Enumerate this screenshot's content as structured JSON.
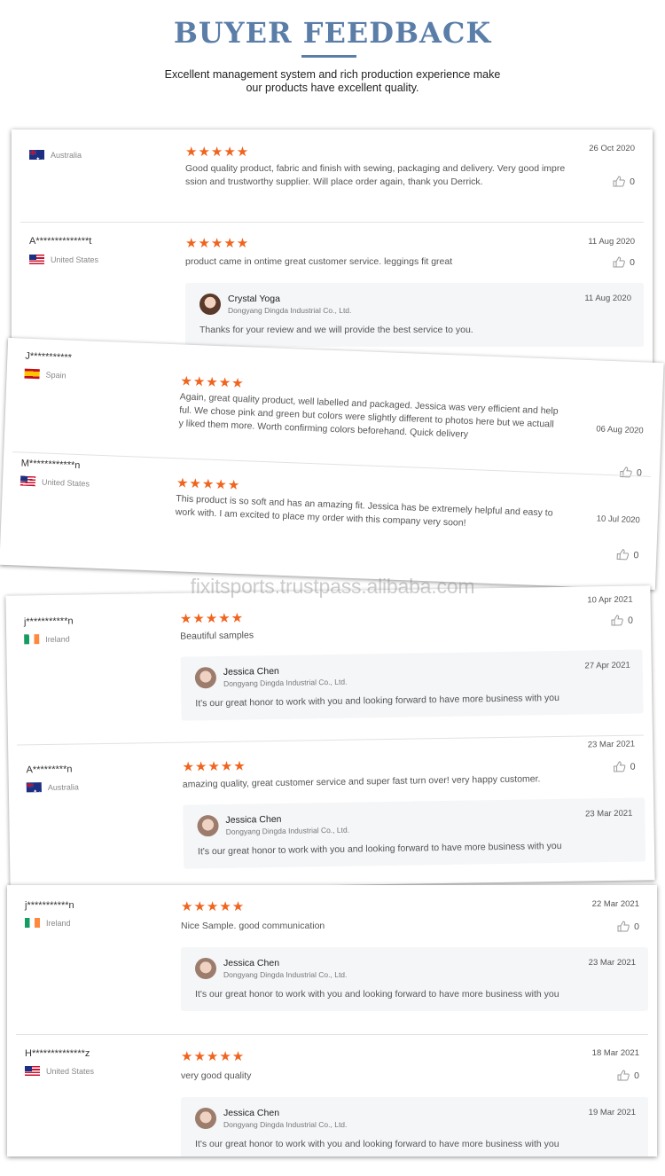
{
  "header": {
    "title": "BUYER FEEDBACK",
    "subtitle_line1": "Excellent management system and rich production experience make",
    "subtitle_line2": "our products have excellent quality."
  },
  "watermark": "fixitsports.trustpass.alibaba.com",
  "stars": "★★★★★",
  "reply_company": "Dongyang Dingda Industrial Co., Ltd.",
  "colors": {
    "title": "#5b7ea8",
    "stars": "#f0641e",
    "reply_bg": "#f5f6f8"
  },
  "cards": [
    {
      "reviews": [
        {
          "name": "",
          "country": "Australia",
          "flag": "australia-flag-icon",
          "date": "26 Oct 2020",
          "text_lines": [
            "Good quality product, fabric and finish with sewing, packaging and delivery. Very good impre",
            "ssion and trustworthy supplier. Will place order again, thank you Derrick."
          ],
          "likes": "0"
        },
        {
          "name": "A**************t",
          "country": "United States",
          "flag": "us-flag-icon",
          "date": "11 Aug 2020",
          "text_lines": [
            "product came in ontime great customer service. leggings fit great"
          ],
          "likes": "0",
          "reply": {
            "name": "Crystal Yoga",
            "date": "11 Aug 2020",
            "text": "Thanks for your review and we will provide the best service to you."
          }
        }
      ]
    },
    {
      "reviews": [
        {
          "name": "J***********",
          "country": "Spain",
          "flag": "spain-flag-icon",
          "date": "06 Aug 2020",
          "text_lines": [
            "Again, great quality product, well labelled and packaged. Jessica was very efficient and help",
            "ful. We chose pink and green but colors were slightly different to photos here but we actuall",
            "y liked them more. Worth confirming colors beforehand. Quick delivery"
          ],
          "likes": "0"
        },
        {
          "name": "M************n",
          "country": "United States",
          "flag": "us-flag-icon",
          "date": "10 Jul 2020",
          "text_lines": [
            "This product is so soft and has an amazing fit. Jessica has be extremely helpful and easy to",
            "work with. I am excited to place my order with this company very soon!"
          ],
          "likes": "0"
        }
      ]
    },
    {
      "reviews": [
        {
          "name": "j***********n",
          "country": "Ireland",
          "flag": "ireland-flag-icon",
          "date": "10 Apr 2021",
          "text_lines": [
            "Beautiful samples"
          ],
          "likes": "0",
          "reply": {
            "name": "Jessica Chen",
            "date": "27 Apr 2021",
            "text": "It's our great honor to work with you and looking forward to have more business with you"
          }
        },
        {
          "name": "A*********n",
          "country": "Australia",
          "flag": "australia-flag-icon",
          "date": "23 Mar 2021",
          "text_lines": [
            "amazing quality, great customer service and super fast turn over! very happy customer."
          ],
          "likes": "0",
          "reply": {
            "name": "Jessica Chen",
            "date": "23 Mar 2021",
            "text": "It's our great honor to work with you and looking forward to have more business with you"
          }
        }
      ]
    },
    {
      "reviews": [
        {
          "name": "j***********n",
          "country": "Ireland",
          "flag": "ireland-flag-icon",
          "date": "22 Mar 2021",
          "text_lines": [
            "Nice Sample. good communication"
          ],
          "likes": "0",
          "reply": {
            "name": "Jessica Chen",
            "date": "23 Mar 2021",
            "text": "It's our great honor to work with you and looking forward to have more business with you"
          }
        },
        {
          "name": "H**************z",
          "country": "United States",
          "flag": "us-flag-icon",
          "date": "18 Mar 2021",
          "text_lines": [
            "very good quality"
          ],
          "likes": "0",
          "reply": {
            "name": "Jessica Chen",
            "date": "19 Mar 2021",
            "text": "It's our great honor to work with you and looking forward to have more business with you"
          }
        }
      ]
    }
  ]
}
